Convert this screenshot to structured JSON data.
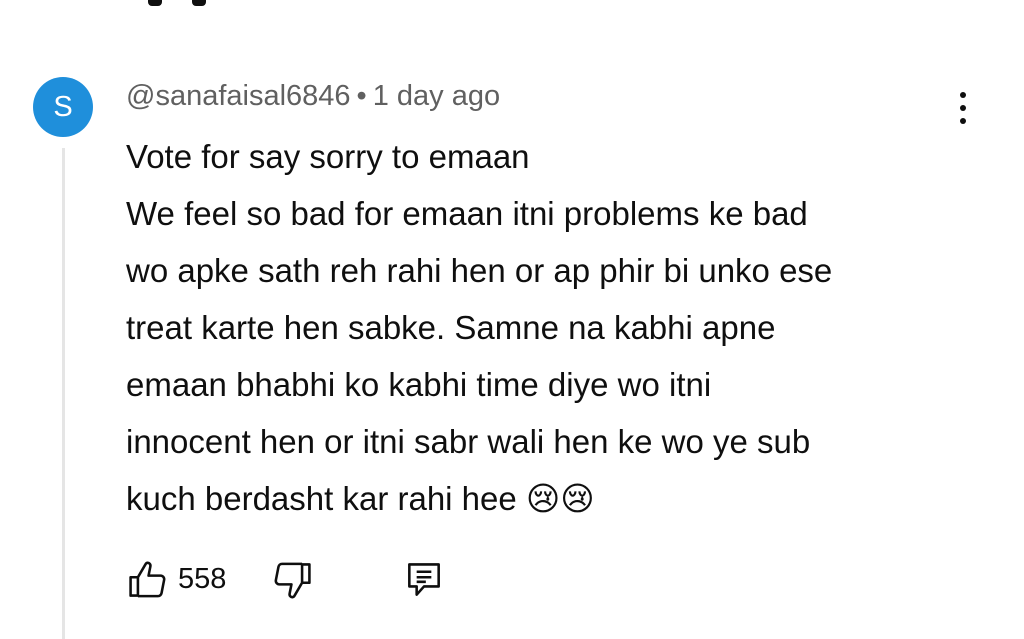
{
  "comment": {
    "avatar_letter": "S",
    "avatar_color": "#1f8fdb",
    "author": "@sanafaisal6846",
    "separator": "•",
    "time": "1 day ago",
    "lines": [
      "Vote for say sorry to emaan",
      "We feel so bad for emaan itni problems ke bad",
      "wo apke sath reh rahi hen or ap phir bi unko ese",
      "treat karte hen sabke. Samne na kabhi apne",
      "emaan bhabhi ko kabhi time diye wo itni",
      "innocent hen or itni sabr wali hen ke wo ye sub",
      "kuch berdasht kar rahi hee 😢😢"
    ],
    "like_count": "558"
  },
  "icons": {
    "more": "more-vertical-icon",
    "like": "thumbs-up-icon",
    "dislike": "thumbs-down-icon",
    "reply": "reply-comment-icon"
  }
}
